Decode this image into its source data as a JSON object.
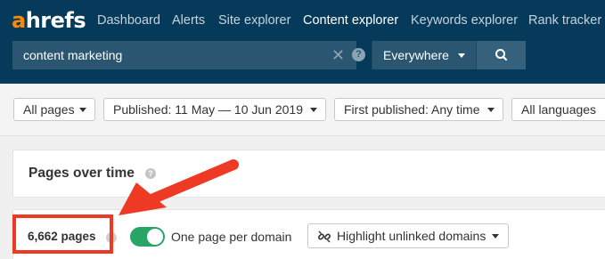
{
  "brand": {
    "logo_accent": "a",
    "logo_rest": "hrefs",
    "accent_color": "#ff8800"
  },
  "nav": {
    "items": [
      {
        "label": "Dashboard"
      },
      {
        "label": "Alerts"
      },
      {
        "label": "Site explorer"
      },
      {
        "label": "Content explorer",
        "active": true
      },
      {
        "label": "Keywords explorer"
      },
      {
        "label": "Rank tracker"
      }
    ]
  },
  "search": {
    "value": "content marketing",
    "help_icon": "?",
    "scope": "Everywhere",
    "icons": {
      "clear": "close-icon",
      "submit": "search-icon"
    }
  },
  "filters": {
    "all_pages": "All pages",
    "published": "Published: 11 May — 10 Jun 2019",
    "first_published": "First published: Any time",
    "languages": "All languages"
  },
  "pages_over_time": {
    "title": "Pages over time",
    "help_icon": "?"
  },
  "results": {
    "count": "6,662 pages",
    "toggle_label": "One page per domain",
    "toggle_on": true,
    "highlight_label": "Highlight unlinked domains"
  },
  "annotation_color": "#ee3a24"
}
